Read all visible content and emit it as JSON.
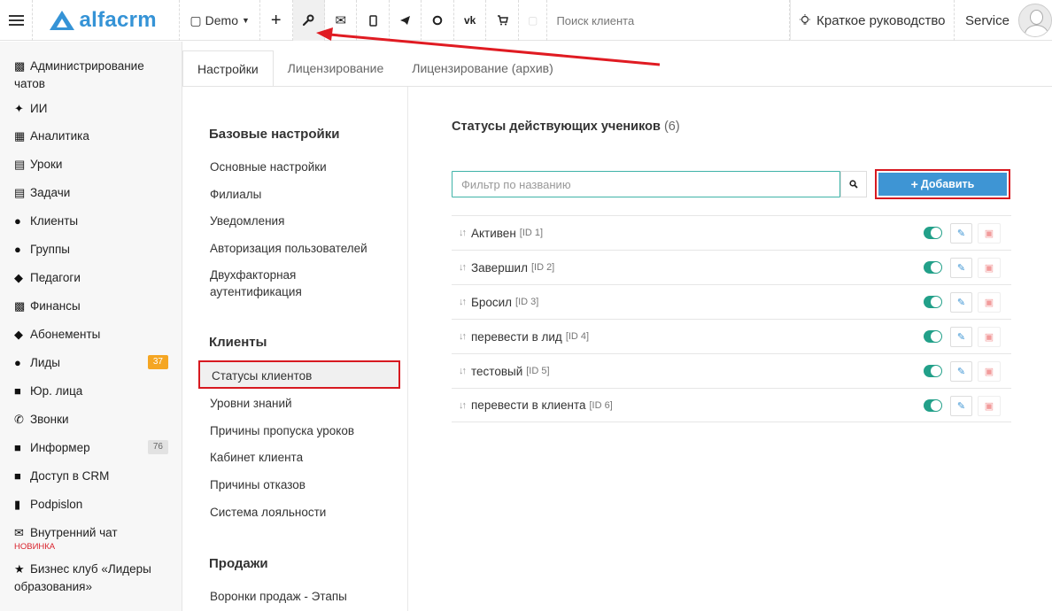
{
  "topbar": {
    "logo_text": "alfacrm",
    "branch_label": "Demo",
    "search_placeholder": "Поиск клиента",
    "guide_label": "Краткое руководство",
    "user_name": "Service"
  },
  "sidebar": {
    "items": [
      {
        "label": "Администрирование чатов",
        "icon": "chat-icon"
      },
      {
        "label": "ИИ",
        "icon": "sparkles-icon"
      },
      {
        "label": "Аналитика",
        "icon": "map-icon"
      },
      {
        "label": "Уроки",
        "icon": "calendar-icon"
      },
      {
        "label": "Задачи",
        "icon": "clipboard-icon"
      },
      {
        "label": "Клиенты",
        "icon": "user-icon"
      },
      {
        "label": "Группы",
        "icon": "users-icon"
      },
      {
        "label": "Педагоги",
        "icon": "graduation-cap-icon"
      },
      {
        "label": "Финансы",
        "icon": "money-icon"
      },
      {
        "label": "Абонементы",
        "icon": "tag-icon"
      },
      {
        "label": "Лиды",
        "icon": "user-plus-icon",
        "badge": "37"
      },
      {
        "label": "Юр. лица",
        "icon": "briefcase-icon"
      },
      {
        "label": "Звонки",
        "icon": "phone-icon"
      },
      {
        "label": "Информер",
        "icon": "book-icon",
        "badge": "76"
      },
      {
        "label": "Доступ в CRM",
        "icon": "lock-icon"
      },
      {
        "label": "Podpislon",
        "icon": "file-icon"
      },
      {
        "label": "Внутренний чат",
        "icon": "envelope-icon",
        "tag": "НОВИНКА"
      },
      {
        "label": "Бизнес клуб «Лидеры образования»",
        "icon": "star-icon"
      }
    ]
  },
  "tabs": [
    "Настройки",
    "Лицензирование",
    "Лицензирование (архив)"
  ],
  "settings": {
    "sections": [
      {
        "title": "Базовые настройки",
        "links": [
          "Основные настройки",
          "Филиалы",
          "Уведомления",
          "Авторизация пользователей",
          "Двухфакторная аутентификация"
        ]
      },
      {
        "title": "Клиенты",
        "links": [
          "Статусы клиентов",
          "Уровни знаний",
          "Причины пропуска уроков",
          "Кабинет клиента",
          "Причины отказов",
          "Система лояльности"
        ]
      },
      {
        "title": "Продажи",
        "links": [
          "Воронки продаж - Этапы"
        ]
      }
    ]
  },
  "main": {
    "title": "Статусы действующих учеников",
    "count": "(6)",
    "filter_placeholder": "Фильтр по названию",
    "add_label": "Добавить",
    "statuses": [
      {
        "name": "Активен",
        "id": "[ID 1]",
        "enabled": true
      },
      {
        "name": "Завершил",
        "id": "[ID 2]",
        "enabled": true
      },
      {
        "name": "Бросил",
        "id": "[ID 3]",
        "enabled": true
      },
      {
        "name": "перевести в лид",
        "id": "[ID 4]",
        "enabled": true
      },
      {
        "name": "тестовый",
        "id": "[ID 5]",
        "enabled": true
      },
      {
        "name": "перевести в клиента",
        "id": "[ID 6]",
        "enabled": true
      }
    ]
  },
  "colors": {
    "accent": "#3e95d4",
    "toggle_on": "#22a089",
    "annotation": "#d71920",
    "badge_orange": "#f5a623"
  }
}
